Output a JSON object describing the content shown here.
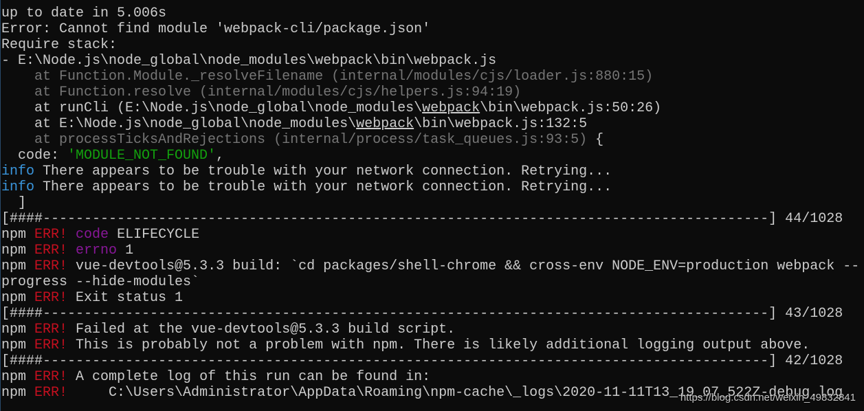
{
  "colors": {
    "background": "#0c0c0c",
    "default": "#cccccc",
    "gray": "#767676",
    "green": "#13a10e",
    "red": "#c50f1f",
    "magenta": "#881798",
    "blue": "#3a96dd"
  },
  "lines": [
    [
      {
        "t": "up to date in 5.006s",
        "c": "default"
      }
    ],
    [
      {
        "t": "Error: Cannot find module 'webpack-cli/package.json'",
        "c": "default"
      }
    ],
    [
      {
        "t": "Require stack:",
        "c": "default"
      }
    ],
    [
      {
        "t": "- E:\\Node.js\\node_global\\node_modules\\webpack\\bin\\webpack.js",
        "c": "default"
      }
    ],
    [
      {
        "t": "    at Function.Module._resolveFilename (internal/modules/cjs/loader.js:880:15)",
        "c": "gray"
      }
    ],
    [
      {
        "t": "    at Function.resolve (internal/modules/cjs/helpers.js:94:19)",
        "c": "gray"
      }
    ],
    [
      {
        "t": "    at runCli (E:\\Node.js\\node_global\\node_modules\\",
        "c": "default"
      },
      {
        "t": "webpack",
        "c": "default",
        "u": true
      },
      {
        "t": "\\bin\\webpack.js:50:26)",
        "c": "default"
      }
    ],
    [
      {
        "t": "    at E:\\Node.js\\node_global\\node_modules\\",
        "c": "default"
      },
      {
        "t": "webpack",
        "c": "default",
        "u": true
      },
      {
        "t": "\\bin\\webpack.js:132:5",
        "c": "default"
      }
    ],
    [
      {
        "t": "    at processTicksAndRejections (internal/process/task_queues.js:93:5)",
        "c": "gray"
      },
      {
        "t": " {",
        "c": "default"
      }
    ],
    [
      {
        "t": "  code: ",
        "c": "default"
      },
      {
        "t": "'MODULE_NOT_FOUND'",
        "c": "green"
      },
      {
        "t": ",",
        "c": "default"
      }
    ],
    [
      {
        "t": "info",
        "c": "blue"
      },
      {
        "t": " There appears to be trouble with your network connection. Retrying...",
        "c": "default"
      }
    ],
    [
      {
        "t": "info",
        "c": "blue"
      },
      {
        "t": " There appears to be trouble with your network connection. Retrying...",
        "c": "default"
      }
    ],
    [
      {
        "t": "  ]",
        "c": "default"
      }
    ],
    [
      {
        "t": "[####----------------------------------------------------------------------------------------] 44/1028",
        "c": "default"
      }
    ],
    [
      {
        "t": "npm ",
        "c": "default"
      },
      {
        "t": "ERR!",
        "c": "red"
      },
      {
        "t": " ",
        "c": "default"
      },
      {
        "t": "code",
        "c": "magenta"
      },
      {
        "t": " ELIFECYCLE",
        "c": "default"
      }
    ],
    [
      {
        "t": "npm ",
        "c": "default"
      },
      {
        "t": "ERR!",
        "c": "red"
      },
      {
        "t": " ",
        "c": "default"
      },
      {
        "t": "errno",
        "c": "magenta"
      },
      {
        "t": " 1",
        "c": "default"
      }
    ],
    [
      {
        "t": "npm ",
        "c": "default"
      },
      {
        "t": "ERR!",
        "c": "red"
      },
      {
        "t": " vue-devtools@5.3.3 build: `cd packages/shell-chrome && cross-env NODE_ENV=production webpack --",
        "c": "default"
      }
    ],
    [
      {
        "t": "progress --hide-modules`",
        "c": "default"
      }
    ],
    [
      {
        "t": "npm ",
        "c": "default"
      },
      {
        "t": "ERR!",
        "c": "red"
      },
      {
        "t": " Exit status 1",
        "c": "default"
      }
    ],
    [
      {
        "t": "[####----------------------------------------------------------------------------------------] 43/1028",
        "c": "default"
      }
    ],
    [
      {
        "t": "npm ",
        "c": "default"
      },
      {
        "t": "ERR!",
        "c": "red"
      },
      {
        "t": " Failed at the vue-devtools@5.3.3 build script.",
        "c": "default"
      }
    ],
    [
      {
        "t": "npm ",
        "c": "default"
      },
      {
        "t": "ERR!",
        "c": "red"
      },
      {
        "t": " This is probably not a problem with npm. There is likely additional logging output above.",
        "c": "default"
      }
    ],
    [
      {
        "t": "[####----------------------------------------------------------------------------------------] 42/1028",
        "c": "default"
      }
    ],
    [
      {
        "t": "npm ",
        "c": "default"
      },
      {
        "t": "ERR!",
        "c": "red"
      },
      {
        "t": " A complete log of this run can be found in:",
        "c": "default"
      }
    ],
    [
      {
        "t": "npm ",
        "c": "default"
      },
      {
        "t": "ERR!",
        "c": "red"
      },
      {
        "t": "     C:\\Users\\Administrator\\AppData\\Roaming\\npm-cache\\_logs\\2020-11-11T13_19_07_522Z-debug.log",
        "c": "default"
      }
    ]
  ],
  "watermark": "https://blog.csdn.net/weixin_49832841"
}
